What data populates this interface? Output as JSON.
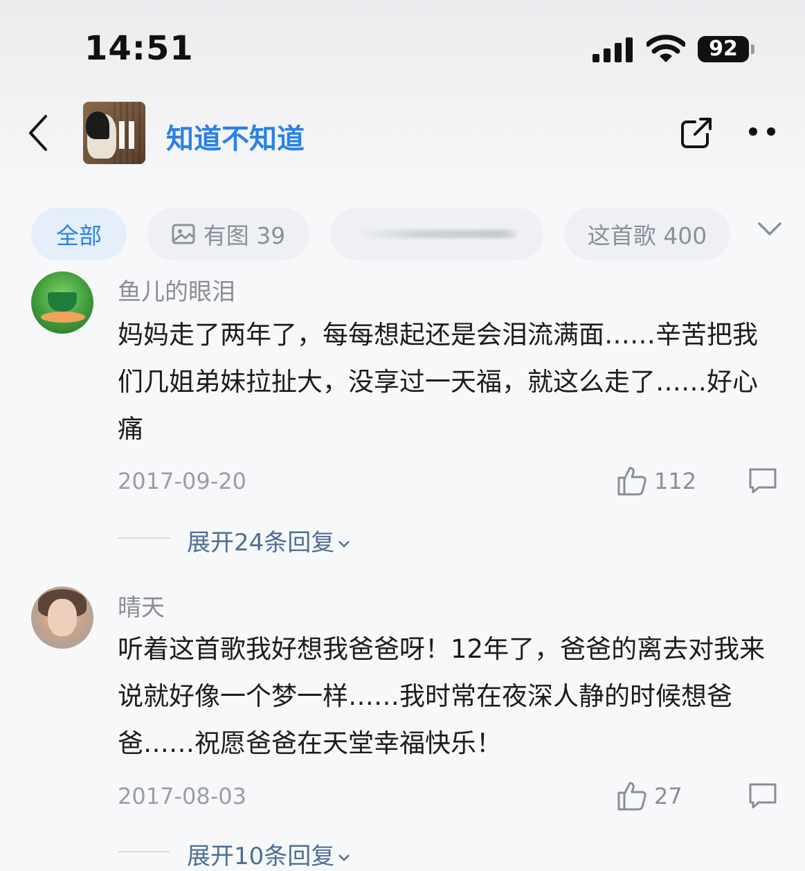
{
  "status_bar": {
    "time": "14:51",
    "battery": "92"
  },
  "nav": {
    "title": "知道不知道",
    "icons": [
      "back-icon",
      "share-icon",
      "more-icon"
    ]
  },
  "tabs": [
    {
      "label": "全部",
      "active": true
    },
    {
      "label": "有图 39",
      "icon": "image-icon"
    },
    {
      "label": ""
    },
    {
      "label": "这首歌 400"
    }
  ],
  "comments": [
    {
      "nickname": "鱼儿的眼泪",
      "text": "妈妈走了两年了，每每想起还是会泪流满面……辛苦把我们几姐弟妹拉扯大，没享过一天福，就这么走了……好心痛",
      "date": "2017-09-20",
      "likes": "112",
      "expand": "展开24条回复"
    },
    {
      "nickname": "晴天",
      "text": "听着这首歌我好想我爸爸呀！12年了，爸爸的离去对我来说就好像一个梦一样……我时常在夜深人静的时候想爸爸……祝愿爸爸在天堂幸福快乐！",
      "date": "2017-08-03",
      "likes": "27",
      "expand": "展开10条回复"
    }
  ],
  "colors": {
    "accent": "#2a82e4",
    "link": "#4e6e93"
  }
}
